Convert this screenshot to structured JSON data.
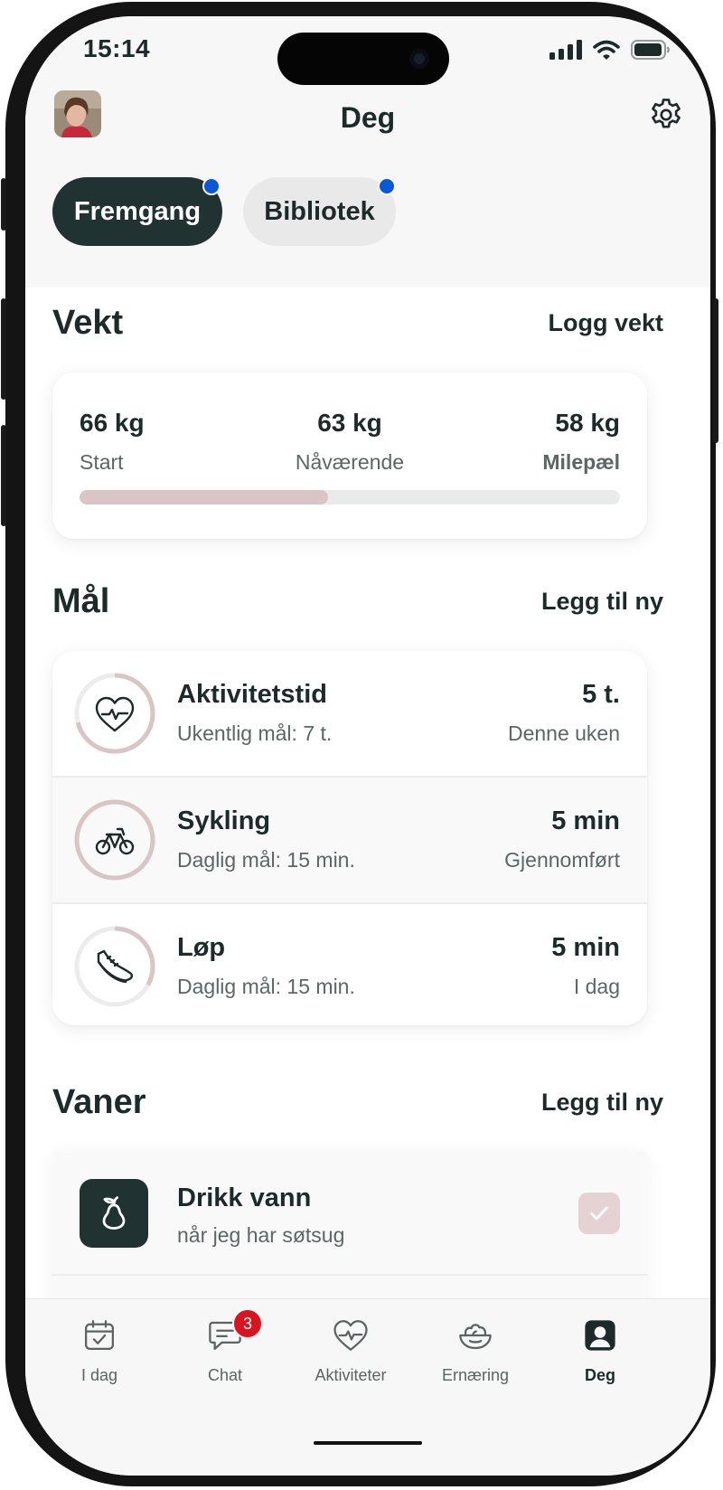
{
  "status_bar": {
    "time": "15:14"
  },
  "header": {
    "title": "Deg"
  },
  "tabs": [
    {
      "label": "Fremgang",
      "active": true,
      "has_dot": true
    },
    {
      "label": "Bibliotek",
      "active": false,
      "has_dot": true
    }
  ],
  "weight": {
    "title": "Vekt",
    "action": "Logg vekt",
    "start_value": "66 kg",
    "start_label": "Start",
    "current_value": "63 kg",
    "current_label": "Nåværende",
    "milestone_value": "58 kg",
    "milestone_label": "Milepæl",
    "progress_fraction": 0.46
  },
  "goals": {
    "title": "Mål",
    "action": "Legg til ny",
    "items": [
      {
        "name": "Aktivitetstid",
        "sub": "Ukentlig mål: 7 t.",
        "value": "5 t.",
        "state": "Denne uken",
        "icon": "heart-pulse-icon",
        "progress": 0.71
      },
      {
        "name": "Sykling",
        "sub": "Daglig mål: 15 min.",
        "value": "5 min",
        "state": "Gjennomført",
        "icon": "bicycle-icon",
        "progress": 1.0
      },
      {
        "name": "Løp",
        "sub": "Daglig mål: 15 min.",
        "value": "5 min",
        "state": "I dag",
        "icon": "running-shoe-icon",
        "progress": 0.33
      }
    ]
  },
  "habits": {
    "title": "Vaner",
    "action": "Legg til ny",
    "items": [
      {
        "name": "Drikk vann",
        "sub": "når jeg har søtsug",
        "icon": "pear-icon",
        "checked": true
      }
    ]
  },
  "bottom_nav": [
    {
      "label": "I dag",
      "icon": "calendar-check-icon",
      "active": false
    },
    {
      "label": "Chat",
      "icon": "chat-icon",
      "active": false,
      "badge": "3"
    },
    {
      "label": "Aktiviteter",
      "icon": "heart-pulse-icon",
      "active": false
    },
    {
      "label": "Ernæring",
      "icon": "salad-bowl-icon",
      "active": false
    },
    {
      "label": "Deg",
      "icon": "person-icon",
      "active": true
    }
  ],
  "colors": {
    "dark": "#203231",
    "accent_rose": "#d9c5c6",
    "notification_dot": "#0a58d8",
    "badge_red": "#d7141f"
  }
}
